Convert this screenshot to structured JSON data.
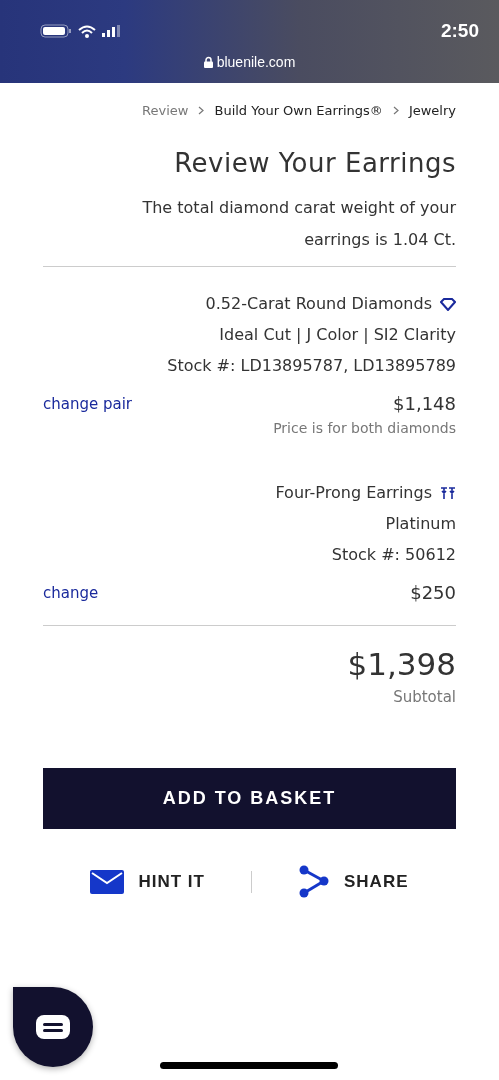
{
  "status_bar": {
    "time": "2:50",
    "url": "bluenile.com"
  },
  "breadcrumb": [
    {
      "label": "Review",
      "current": true
    },
    {
      "label": "Build Your Own Earrings®",
      "current": false
    },
    {
      "label": "Jewelry",
      "current": false
    }
  ],
  "title": "Review Your Earrings",
  "description": "The total diamond carat weight of your earrings is 1.04 Ct.",
  "items": [
    {
      "kind": "diamond",
      "name": "0.52-Carat Round Diamonds",
      "details": [
        "Ideal Cut | J Color | SI2 Clarity",
        "Stock #: LD13895787, LD13895789"
      ],
      "price": "$1,148",
      "note": "Price is for both diamonds",
      "action": "change pair"
    },
    {
      "kind": "setting",
      "name": "Four-Prong Earrings",
      "details": [
        "Platinum",
        "Stock #: 50612"
      ],
      "price": "$250",
      "action": "change"
    }
  ],
  "subtotal": {
    "amount": "$1,398",
    "label": "Subtotal"
  },
  "add_button": "ADD TO BASKET",
  "actions": [
    {
      "kind": "hint",
      "label": "HINT IT"
    },
    {
      "kind": "share",
      "label": "SHARE"
    }
  ]
}
